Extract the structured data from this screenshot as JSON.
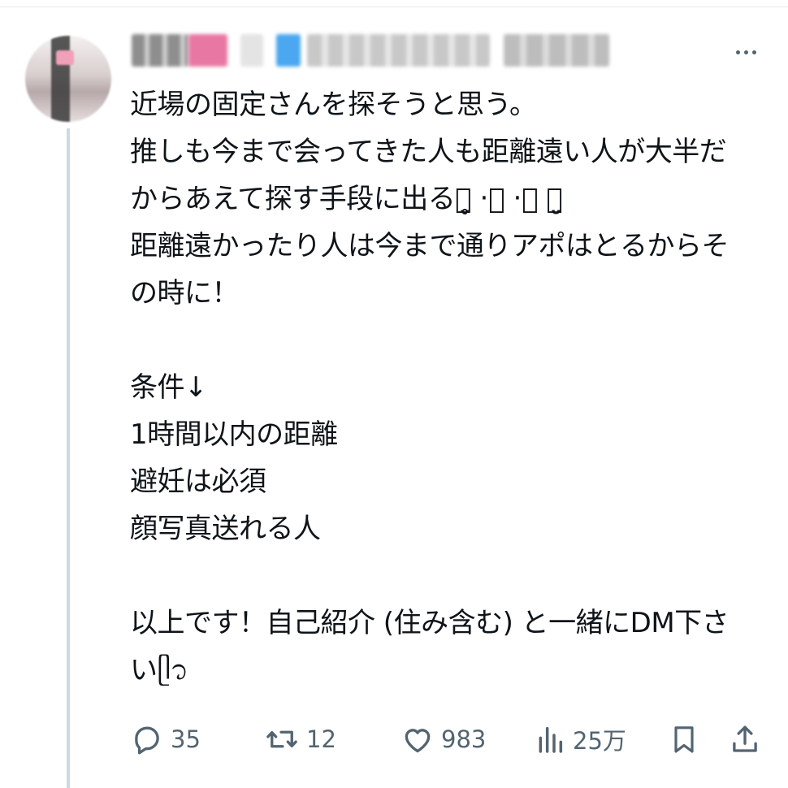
{
  "tweet": {
    "lines": [
      "近場の固定さんを探そうと思う。",
      "推しも今まで会ってきた人も距離遠い人が大半だ",
      "からあえて探す手段に出るꪔ̤̥ ‧͙ ‧͙ ꪔ̤̮",
      "距離遠かったり人は今まで通りアポはとるからそ",
      "の時に！",
      "",
      "条件↓",
      "1時間以内の距離",
      "避妊は必須",
      "顔写真送れる人",
      "",
      "以上です！自己紹介 (住み含む) と一緒にDM下さ",
      "いᥫ᭡"
    ]
  },
  "actions": {
    "reply_count": "35",
    "retweet_count": "12",
    "like_count": "983",
    "view_count": "25万"
  },
  "icons": {
    "reply": "reply-icon",
    "retweet": "retweet-icon",
    "like": "heart-icon",
    "views": "views-icon",
    "bookmark": "bookmark-icon",
    "share": "share-icon",
    "more": "more-dots-icon"
  },
  "colors": {
    "icon_gray": "#536471",
    "text": "#0f1419",
    "thread_line": "#cfd9de"
  }
}
